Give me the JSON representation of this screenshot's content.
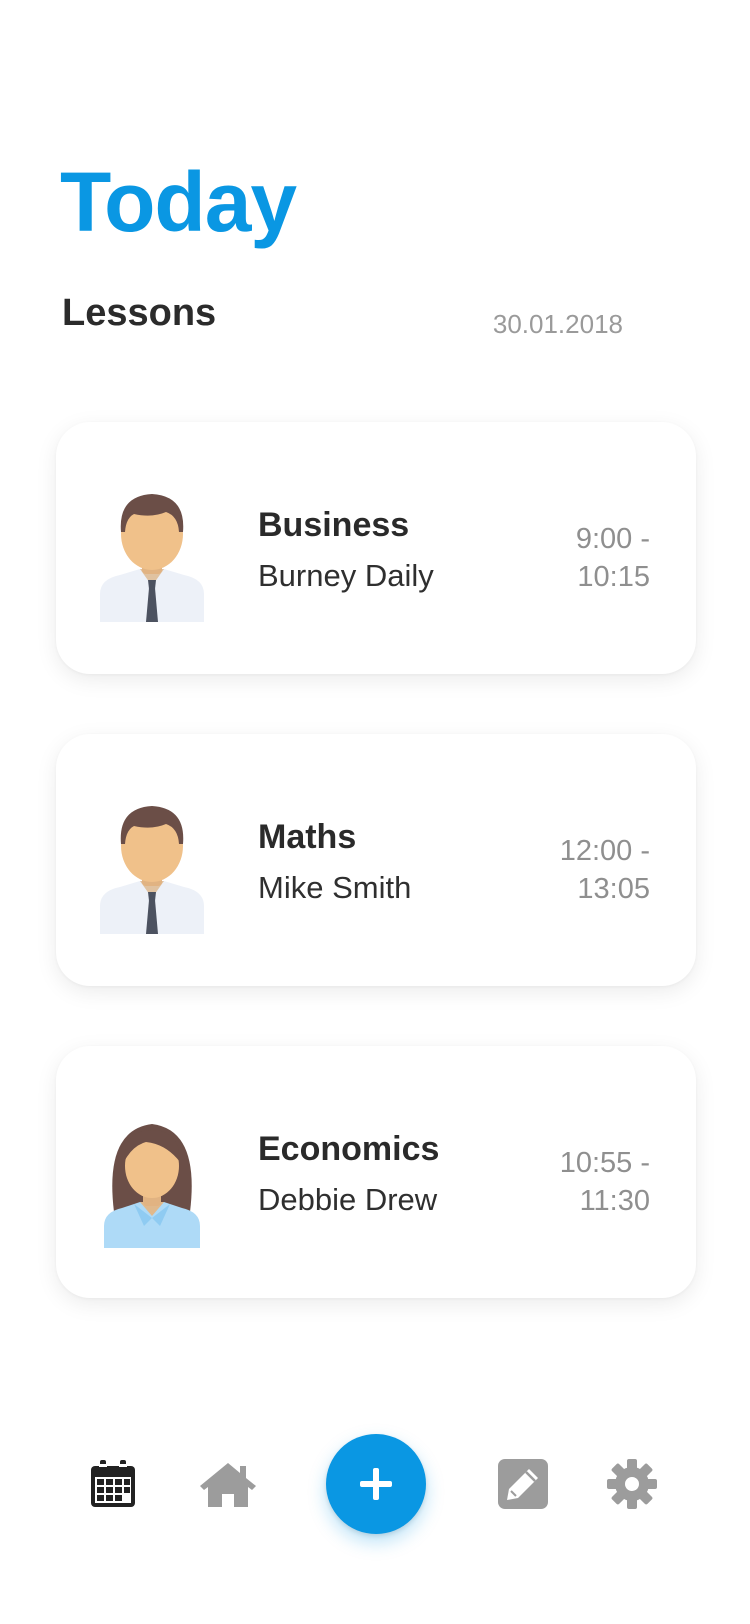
{
  "header": {
    "title": "Today",
    "section_title": "Lessons",
    "date": "30.01.2018"
  },
  "lessons": [
    {
      "subject": "Business",
      "teacher": "Burney Daily",
      "time_start": "9:00 -",
      "time_end": "10:15",
      "avatar": "male-avatar-icon"
    },
    {
      "subject": "Maths",
      "teacher": "Mike Smith",
      "time_start": "12:00 -",
      "time_end": "13:05",
      "avatar": "male-avatar-icon"
    },
    {
      "subject": "Economics",
      "teacher": "Debbie Drew",
      "time_start": "10:55 -",
      "time_end": "11:30",
      "avatar": "female-avatar-icon"
    }
  ],
  "nav": {
    "items": [
      {
        "icon": "calendar-icon",
        "active": true
      },
      {
        "icon": "home-icon",
        "active": false
      },
      {
        "icon": "plus-icon",
        "active": false
      },
      {
        "icon": "pencil-icon",
        "active": false
      },
      {
        "icon": "gear-icon",
        "active": false
      }
    ]
  },
  "colors": {
    "accent": "#0a97e3",
    "active_icon": "#222222",
    "inactive_icon": "#9c9c9c",
    "muted_text": "#9a9a9a"
  }
}
